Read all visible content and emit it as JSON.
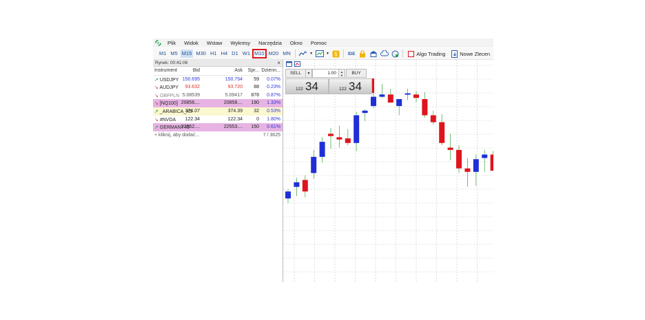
{
  "menu": [
    "Plik",
    "Widok",
    "Wstaw",
    "Wykresy",
    "Narzędzia",
    "Okno",
    "Pomoc"
  ],
  "timeframes": [
    "M1",
    "M5",
    "M15",
    "M30",
    "H1",
    "H4",
    "D1",
    "W1",
    "M10",
    "M20",
    "MN"
  ],
  "active_timeframe": "M15",
  "highlighted_timeframe": "M10",
  "toolbar": {
    "ide_label": "IDE",
    "algo_trading": "Algo Trading",
    "new_order": "Nowe Zlecen"
  },
  "market_watch": {
    "title": "Rynek: 00:41:06",
    "close": "×",
    "columns": [
      "Instrument",
      "Bid",
      "Ask",
      "Spr...",
      "Dzienn..."
    ],
    "rows": [
      {
        "arrow": "↗",
        "dir": "up",
        "name": "USDJPY",
        "bid": "150.695",
        "ask": "150.754",
        "spread": "59",
        "daily": "0.07%",
        "bg": "",
        "price_color": "blue",
        "daily_color": "blue"
      },
      {
        "arrow": "↘",
        "dir": "down",
        "name": "AUDJPY",
        "bid": "93.632",
        "ask": "93.720",
        "spread": "88",
        "daily": "0.23%",
        "bg": "",
        "price_color": "red",
        "daily_color": "blue"
      },
      {
        "arrow": "↘",
        "dir": "down",
        "name": "GBPPLN",
        "bid": "5.08539",
        "ask": "5.09417",
        "spread": "878",
        "daily": "0.87%",
        "bg": "",
        "price_color": "",
        "daily_color": "blue",
        "name_color": "gray"
      },
      {
        "arrow": "↘",
        "dir": "down",
        "name": "[NQ100]",
        "bid": "20856....",
        "ask": "20858....",
        "spread": "190",
        "daily": "1.33%",
        "bg": "pink",
        "price_color": "",
        "daily_color": "blue"
      },
      {
        "arrow": "↗",
        "dir": "up",
        "name": "_ARABICA_K5",
        "bid": "374.07",
        "ask": "374.39",
        "spread": "32",
        "daily": "0.53%",
        "bg": "yellow",
        "price_color": "",
        "daily_color": "blue"
      },
      {
        "arrow": "↘",
        "dir": "down",
        "name": "#NVDA",
        "bid": "122.34",
        "ask": "122.34",
        "spread": "0",
        "daily": "1.80%",
        "bg": "",
        "price_color": "",
        "daily_color": "blue"
      },
      {
        "arrow": "↗",
        "dir": "up",
        "name": "GERMANY40",
        "bid": "22552....",
        "ask": "22553....",
        "spread": "150",
        "daily": "0.61%",
        "bg": "pink",
        "price_color": "",
        "daily_color": "blue"
      }
    ],
    "add_label": "+ kliknij, aby dodać...",
    "count": "7 / 3625"
  },
  "trade_panel": {
    "sell": "SELL",
    "buy": "BUY",
    "lot": "1.00",
    "sell_small": "122",
    "sell_big": "34",
    "buy_small": "122",
    "buy_big": "34"
  },
  "colors": {
    "bull": "#1f2fd8",
    "bear": "#e0141e",
    "wick": "#4caf50",
    "highlight": "#e0141e",
    "row_pink": "#e6b3e3",
    "row_yellow": "#fbf7cf"
  },
  "chart_data": {
    "type": "candlestick",
    "grid": true,
    "candles": [
      {
        "o": 130.6,
        "h": 131.4,
        "l": 130.2,
        "c": 131.2
      },
      {
        "o": 131.6,
        "h": 132.4,
        "l": 130.8,
        "c": 132.0
      },
      {
        "o": 132.2,
        "h": 132.6,
        "l": 130.7,
        "c": 131.2
      },
      {
        "o": 132.8,
        "h": 134.8,
        "l": 132.3,
        "c": 134.2
      },
      {
        "o": 134.2,
        "h": 135.9,
        "l": 133.7,
        "c": 135.5
      },
      {
        "o": 136.2,
        "h": 136.7,
        "l": 134.9,
        "c": 136.0
      },
      {
        "o": 135.9,
        "h": 136.9,
        "l": 135.0,
        "c": 135.7
      },
      {
        "o": 135.8,
        "h": 136.6,
        "l": 135.2,
        "c": 135.4
      },
      {
        "o": 135.4,
        "h": 138.1,
        "l": 134.7,
        "c": 137.8
      },
      {
        "o": 138.0,
        "h": 138.3,
        "l": 137.3,
        "c": 138.2
      },
      {
        "o": 138.6,
        "h": 140.3,
        "l": 138.4,
        "c": 139.4
      },
      {
        "o": 139.4,
        "h": 140.5,
        "l": 139.3,
        "c": 139.6
      },
      {
        "o": 139.6,
        "h": 140.1,
        "l": 138.9,
        "c": 138.9
      },
      {
        "o": 138.6,
        "h": 139.1,
        "l": 137.8,
        "c": 139.2
      },
      {
        "o": 139.6,
        "h": 140.1,
        "l": 139.1,
        "c": 139.7
      },
      {
        "o": 139.6,
        "h": 139.9,
        "l": 138.9,
        "c": 139.3
      },
      {
        "o": 139.2,
        "h": 139.8,
        "l": 137.6,
        "c": 137.8
      },
      {
        "o": 137.8,
        "h": 138.2,
        "l": 137.0,
        "c": 137.2
      },
      {
        "o": 137.2,
        "h": 137.9,
        "l": 135.2,
        "c": 135.4
      },
      {
        "o": 135.0,
        "h": 136.2,
        "l": 133.9,
        "c": 134.8
      },
      {
        "o": 134.8,
        "h": 135.2,
        "l": 132.8,
        "c": 133.2
      },
      {
        "o": 133.2,
        "h": 134.1,
        "l": 131.6,
        "c": 132.9
      },
      {
        "o": 132.9,
        "h": 134.4,
        "l": 131.7,
        "c": 134.0
      },
      {
        "o": 134.1,
        "h": 134.8,
        "l": 132.9,
        "c": 134.4
      },
      {
        "o": 134.4,
        "h": 134.7,
        "l": 133.4,
        "c": 133.0
      }
    ]
  }
}
